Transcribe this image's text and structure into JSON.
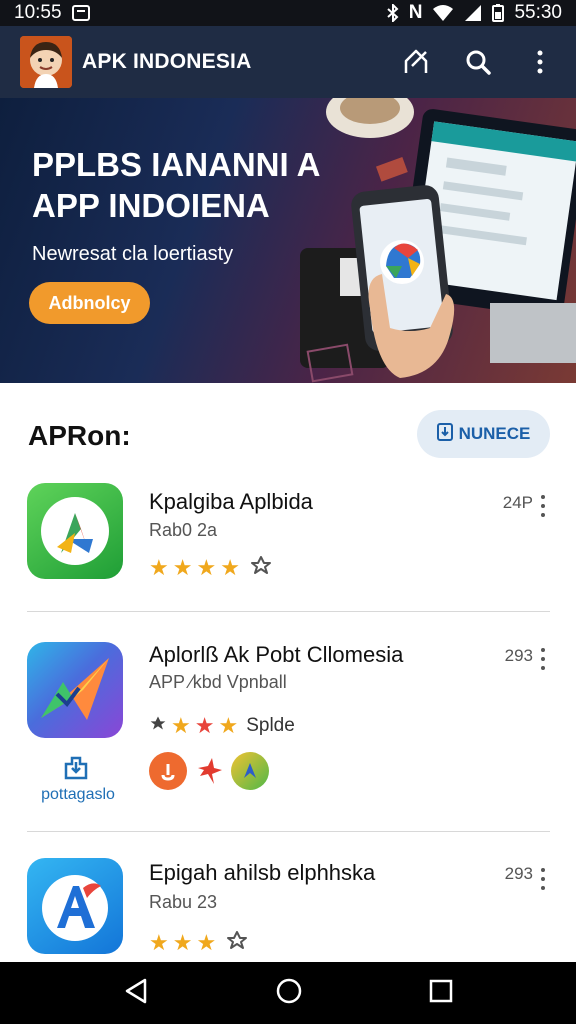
{
  "status_bar": {
    "time": "10:55",
    "clock_right": "55:30",
    "network_text": "N"
  },
  "app_bar": {
    "title": "APK INDONESIA",
    "actions": [
      "share-icon",
      "search-icon",
      "more-vert-icon"
    ]
  },
  "banner": {
    "title_line1": "PPLBS IANANNI A",
    "title_line2": "APP INDOIENA",
    "subtitle": "Newresat cla loertiasty",
    "button_label": "Adbnolcy"
  },
  "section": {
    "title": "APRon:",
    "button_label": "NUNECE"
  },
  "apps": [
    {
      "name": "Kpalgiba Aplbida",
      "meta": "Rab0 2a",
      "size": "24P",
      "stars": 4
    },
    {
      "name": "Aplorlß Ak Pobt Cllomesia",
      "meta": "APP ∕kbd Vpnball",
      "size": "293",
      "rating_label": "Splde",
      "link_label": "pottagaslo"
    },
    {
      "name": "Epigah ahilsb elphhska",
      "meta": "Rabu 23",
      "size": "293",
      "stars": 3
    }
  ],
  "colors": {
    "app_bar": "#1f2c44",
    "accent_orange": "#f19a2c",
    "star": "#f0a81d",
    "link_blue": "#1f6fb5"
  },
  "nav": [
    "back-icon",
    "home-icon",
    "recents-icon"
  ]
}
